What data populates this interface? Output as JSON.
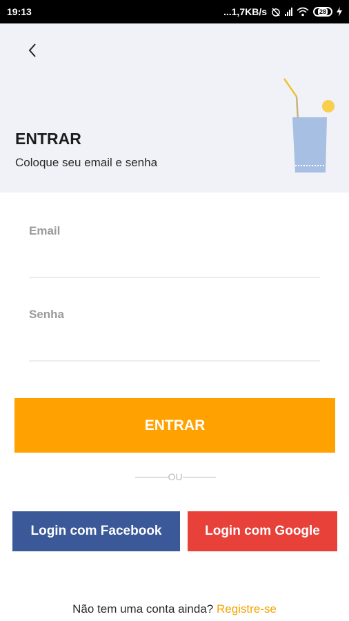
{
  "status_bar": {
    "time": "19:13",
    "network_speed": "...1,7KB/s",
    "battery": "28"
  },
  "header": {
    "back_icon": "chevron-left-icon",
    "title": "ENTRAR",
    "subtitle": "Coloque seu email e senha",
    "illustration_icon": "drink-glass-icon"
  },
  "form": {
    "email_placeholder": "Email",
    "email_value": "",
    "password_placeholder": "Senha",
    "password_value": "",
    "submit_label": "ENTRAR"
  },
  "divider": {
    "label": "OU"
  },
  "social": {
    "facebook_label": "Login com Facebook",
    "google_label": "Login com Google"
  },
  "signup": {
    "prompt": "Não tem uma conta ainda?",
    "link": "Registre-se"
  },
  "colors": {
    "accent": "#ffa100",
    "facebook": "#3b5998",
    "google": "#e7413a",
    "header_bg": "#f0f2f7",
    "link": "#f4a300"
  }
}
